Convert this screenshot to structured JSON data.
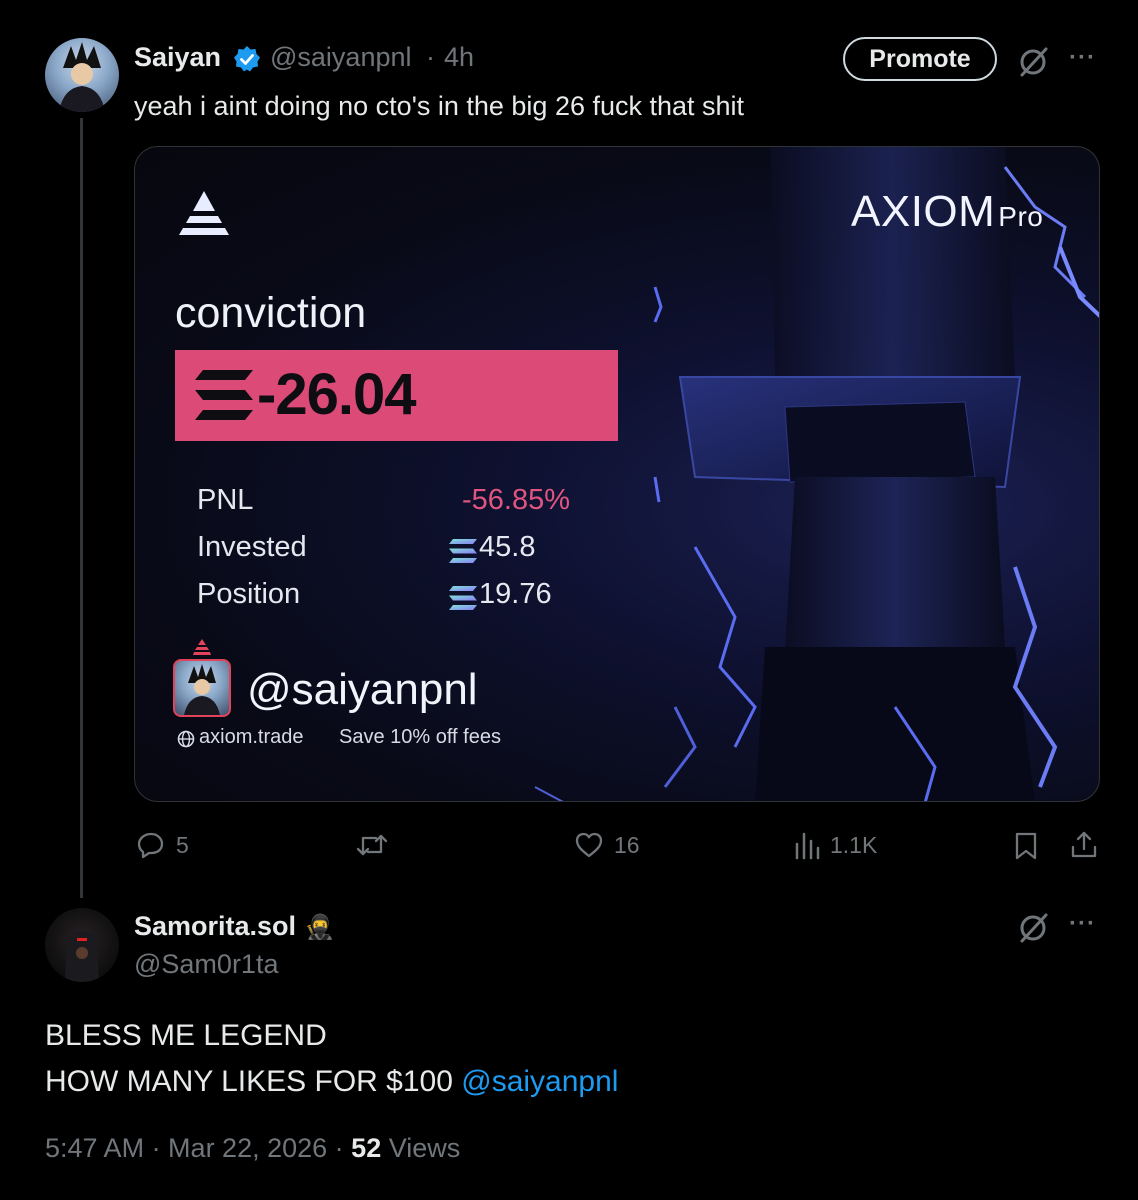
{
  "post": {
    "author_name": "Saiyan",
    "author_handle": "@saiyanpnl",
    "time_sep": "·",
    "age": "4h",
    "text": "yeah i aint doing no cto's in the big 26 fuck that shit",
    "promote_label": "Promote",
    "more_label": "···",
    "card": {
      "brand": "AXIOM",
      "brand_suffix": "Pro",
      "token": "conviction",
      "pnl_value": "-26.04",
      "rows": [
        {
          "label": "PNL",
          "value": "-56.85%"
        },
        {
          "label": "Invested",
          "value": "45.8"
        },
        {
          "label": "Position",
          "value": "19.76"
        }
      ],
      "user_handle": "@saiyanpnl",
      "site": "axiom.trade",
      "promo": "Save 10% off fees",
      "colors": {
        "pnl_bar": "#dc4a77",
        "negative": "#e0557f",
        "accent": "#5a6cf0"
      }
    },
    "actions": {
      "replies": "5",
      "reposts": "",
      "likes": "16",
      "views": "1.1K"
    }
  },
  "reply": {
    "author_name": "Samorita.sol",
    "author_emoji": "🥷",
    "author_handle": "@Sam0r1ta",
    "text_line1": "BLESS ME LEGEND",
    "text_line2": "HOW MANY LIKES FOR $100",
    "mention": "@saiyanpnl",
    "timestamp": "5:47 AM · Mar 22, 2026 ·",
    "views_count": "52",
    "views_label": "Views",
    "more_label": "···"
  },
  "icons": [
    "verified-badge-icon",
    "grok-icon",
    "more-icon",
    "reply-icon",
    "repost-icon",
    "like-icon",
    "views-icon",
    "bookmark-icon",
    "share-icon",
    "globe-icon",
    "axiom-logo-icon",
    "solana-icon"
  ]
}
